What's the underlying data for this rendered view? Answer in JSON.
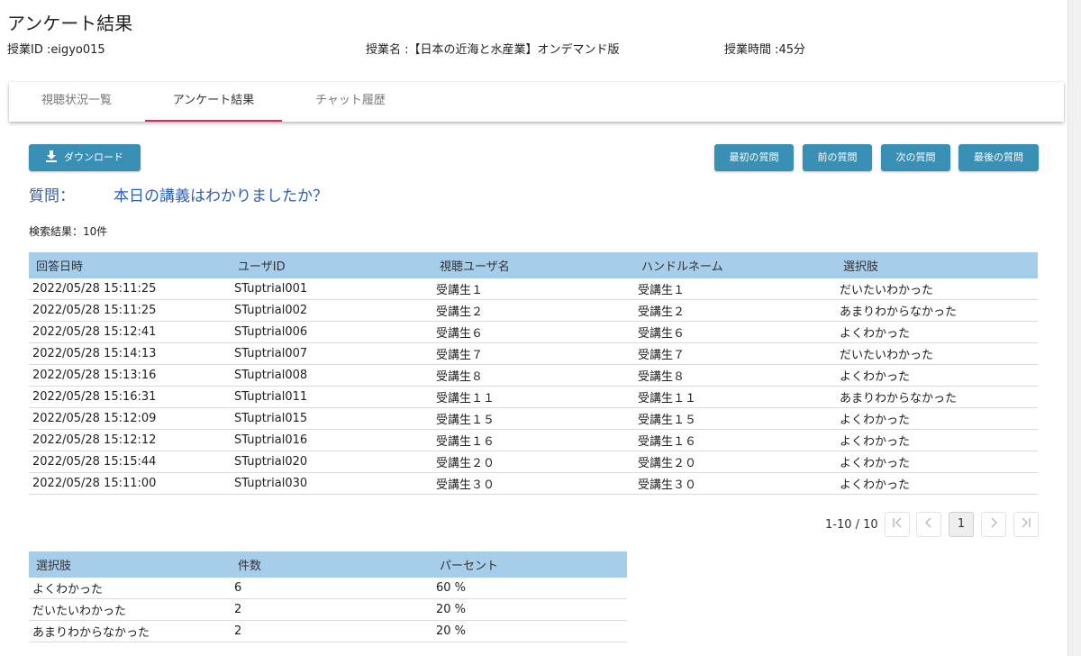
{
  "page": {
    "title": "アンケート結果",
    "lesson_id": "授業ID :eigyo015",
    "lesson_name": "授業名 :【日本の近海と水産業】オンデマンド版",
    "lesson_time": "授業時間 :45分"
  },
  "tabs": [
    "視聴状況一覧",
    "アンケート結果",
    "チャット履歴"
  ],
  "toolbar": {
    "download": "ダウンロード",
    "first": "最初の質問",
    "prev": "前の質問",
    "next": "次の質問",
    "last": "最後の質問"
  },
  "question": {
    "label": "質問：",
    "text": "本日の講義はわかりましたか？"
  },
  "result_count": "検索結果：10件",
  "answers": {
    "headers": [
      "回答日時",
      "ユーザID",
      "視聴ユーザ名",
      "ハンドルネーム",
      "選択肢"
    ],
    "rows": [
      [
        "2022/05/28 15:11:25",
        "STuptrial001",
        "受講生１",
        "受講生１",
        "だいたいわかった"
      ],
      [
        "2022/05/28 15:11:25",
        "STuptrial002",
        "受講生２",
        "受講生２",
        "あまりわからなかった"
      ],
      [
        "2022/05/28 15:12:41",
        "STuptrial006",
        "受講生６",
        "受講生６",
        "よくわかった"
      ],
      [
        "2022/05/28 15:14:13",
        "STuptrial007",
        "受講生７",
        "受講生７",
        "だいたいわかった"
      ],
      [
        "2022/05/28 15:13:16",
        "STuptrial008",
        "受講生８",
        "受講生８",
        "よくわかった"
      ],
      [
        "2022/05/28 15:16:31",
        "STuptrial011",
        "受講生１１",
        "受講生１１",
        "あまりわからなかった"
      ],
      [
        "2022/05/28 15:12:09",
        "STuptrial015",
        "受講生１５",
        "受講生１５",
        "よくわかった"
      ],
      [
        "2022/05/28 15:12:12",
        "STuptrial016",
        "受講生１６",
        "受講生１６",
        "よくわかった"
      ],
      [
        "2022/05/28 15:15:44",
        "STuptrial020",
        "受講生２０",
        "受講生２０",
        "よくわかった"
      ],
      [
        "2022/05/28 15:11:00",
        "STuptrial030",
        "受講生３０",
        "受講生３０",
        "よくわかった"
      ]
    ]
  },
  "pagination": {
    "range": "1-10 / 10",
    "current_page": "1"
  },
  "summary": {
    "headers": [
      "選択肢",
      "件数",
      "パーセント"
    ],
    "rows": [
      [
        "よくわかった",
        "6",
        "60 %"
      ],
      [
        "だいたいわかった",
        "2",
        "20 %"
      ],
      [
        "あまりわからなかった",
        "2",
        "20 %"
      ]
    ]
  },
  "colors": {
    "accent": "#3a8fb5",
    "header_bg": "#a6cdea",
    "question": "#2f5fad",
    "tab_indicator": "#e0245e"
  }
}
